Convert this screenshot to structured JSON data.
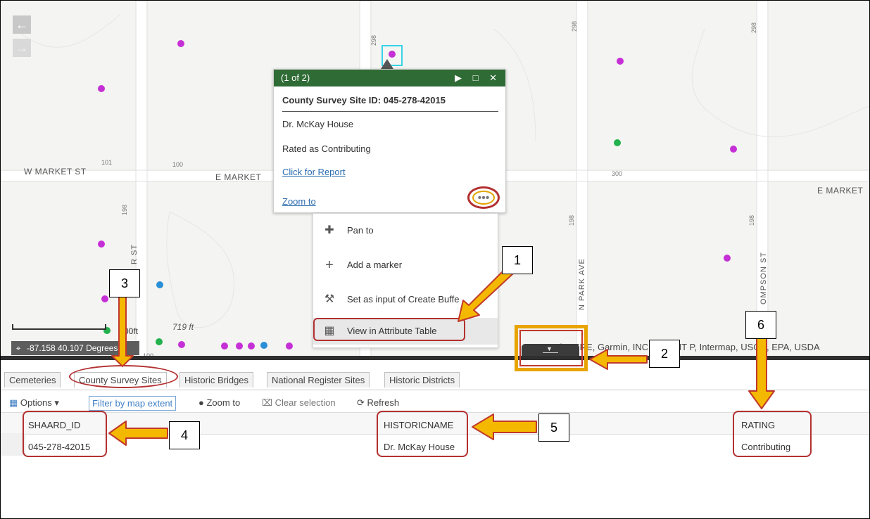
{
  "map": {
    "streets": {
      "w_market": "W MARKET ST",
      "e_market_left": "E MARKET",
      "e_market_right": "E MARKET",
      "n_r_st": "R ST",
      "n_park_ave": "N PARK AVE",
      "thompson_st": "OMPSON ST"
    },
    "addresses": {
      "a101": "101",
      "a100": "100",
      "a300": "300",
      "a298a": "298",
      "a298b": "298",
      "a298c": "298",
      "a198a": "198",
      "a198b": "198",
      "a198c": "198",
      "a100b": "100"
    },
    "nav": {
      "back_icon": "←",
      "forward_icon": "→"
    },
    "scale_label": "00ft",
    "elevation_label": "719 ft",
    "coordinates": "-87.158 40.107 Degrees",
    "attribution": "Esri, HERE, Garmin, INCREMENT P, Intermap, USGS, EPA, USDA",
    "colors": {
      "magenta": "#c530d6",
      "green": "#22b14c",
      "blue": "#2a8fd6"
    }
  },
  "popup": {
    "counter": "(1 of 2)",
    "controls": "▶ □ ✕",
    "heading": "County Survey Site ID: 045-278-42015",
    "name": "Dr. McKay House",
    "rating": "Rated as Contributing",
    "report_link": "Click for Report",
    "zoom_link": "Zoom to",
    "more": "•••"
  },
  "menu": {
    "items": [
      {
        "icon": "pan-icon",
        "glyph": "✚",
        "label": "Pan to"
      },
      {
        "icon": "plus-icon",
        "glyph": "+",
        "label": "Add a marker"
      },
      {
        "icon": "wrench-icon",
        "glyph": "⚒",
        "label": "Set as input of Create Buffe"
      },
      {
        "icon": "table-icon",
        "glyph": "▦",
        "label": "View in Attribute Table"
      }
    ]
  },
  "tabs": [
    "Cemeteries",
    "County Survey Sites",
    "Historic Bridges",
    "National Register Sites",
    "Historic Districts"
  ],
  "toolbar": {
    "options": "Options ▾",
    "filter": "Filter by map extent",
    "zoom_to": "Zoom to",
    "clear_selection": "Clear selection",
    "refresh": "Refresh"
  },
  "table": {
    "columns": [
      "SHAARD_ID",
      "HISTORICNAME",
      "RATING"
    ],
    "row": [
      "045-278-42015",
      "Dr. McKay House",
      "Contributing"
    ]
  },
  "callouts": [
    "1",
    "2",
    "3",
    "4",
    "5",
    "6"
  ]
}
